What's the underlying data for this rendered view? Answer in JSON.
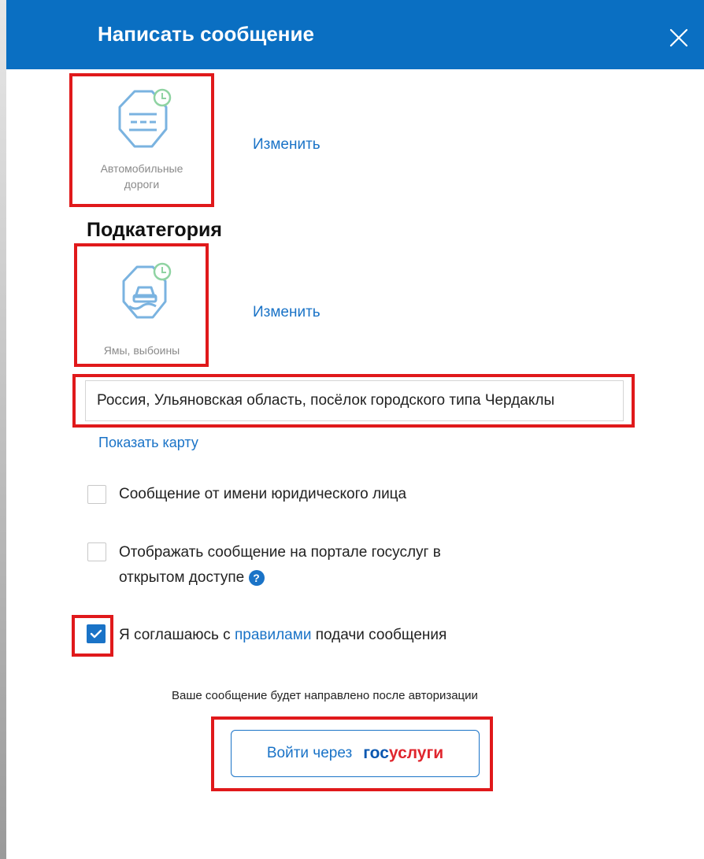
{
  "dialog": {
    "title": "Написать сообщение",
    "close_icon": "close-icon"
  },
  "category": {
    "label": "Автомобильные дороги",
    "icon": "road-icon",
    "change_link": "Изменить"
  },
  "subcategory": {
    "section_title": "Подкатегория",
    "label": "Ямы, выбоины",
    "icon": "pothole-car-icon",
    "change_link": "Изменить"
  },
  "address": {
    "value": "Россия, Ульяновская область, посёлок городского типа Чердаклы",
    "show_map_link": "Показать карту"
  },
  "options": {
    "legal_entity_label": "Сообщение от имени юридического лица",
    "legal_entity_checked": false,
    "public_line1": "Отображать сообщение на портале госуслуг в",
    "public_line2": "открытом доступе",
    "public_checked": false,
    "help_icon": "question-icon",
    "agree_prefix": "Я соглашаюсь с",
    "agree_link": "правилами",
    "agree_suffix": "подачи сообщения",
    "agree_checked": true
  },
  "footer": {
    "note": "Ваше сообщение будет направлено после авторизации",
    "login_label": "Войти через",
    "brand_part1": "гос",
    "brand_part2": "услуги"
  },
  "colors": {
    "header": "#0a6fc2",
    "link": "#1a73c7",
    "highlight": "#e0191b",
    "icon_stroke": "#7ab3e0",
    "status_green": "#8fd3a2"
  }
}
